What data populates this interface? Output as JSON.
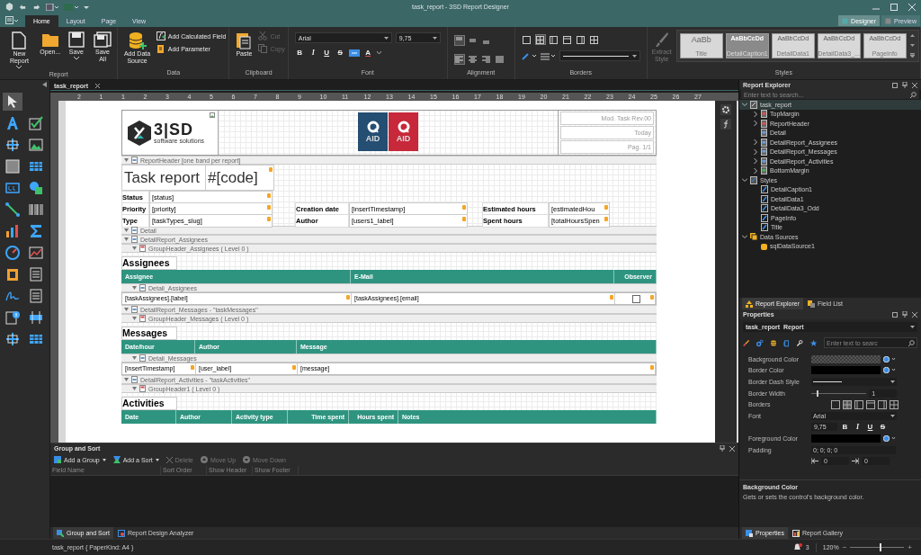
{
  "window": {
    "title": "task_report - 3SD Report Designer"
  },
  "ribbon_tabs": [
    {
      "label": "Home",
      "selected": true
    },
    {
      "label": "Layout",
      "selected": false
    },
    {
      "label": "Page",
      "selected": false
    },
    {
      "label": "View",
      "selected": false
    }
  ],
  "view_switch": [
    {
      "label": "Designer",
      "selected": true
    },
    {
      "label": "Preview",
      "selected": false
    }
  ],
  "ribbon": {
    "report": {
      "title": "Report",
      "buttons": [
        {
          "label": "New Report",
          "dropdown": true
        },
        {
          "label": "Open...",
          "dropdown": false
        },
        {
          "label": "Save",
          "dropdown": true
        },
        {
          "label": "Save All",
          "dropdown": false
        }
      ]
    },
    "data": {
      "title": "Data",
      "large": {
        "label": "Add Data Source"
      },
      "small": [
        {
          "label": "Add Calculated Field"
        },
        {
          "label": "Add Parameter"
        }
      ]
    },
    "clipboard": {
      "title": "Clipboard",
      "large": {
        "label": "Paste"
      },
      "small": [
        {
          "label": "Cut",
          "disabled": true
        },
        {
          "label": "Copy",
          "disabled": true
        }
      ]
    },
    "font": {
      "title": "Font",
      "family": "Arial",
      "size": "9,75",
      "styles": [
        "B",
        "I",
        "U",
        "S"
      ],
      "color_letter": "A"
    },
    "alignment": {
      "title": "Alignment",
      "buttons": [
        {
          "selected": true
        },
        {
          "selected": false
        },
        {
          "selected": false
        },
        {
          "selected": true
        },
        {
          "selected": false
        },
        {
          "selected": false
        },
        {
          "selected": false
        }
      ]
    },
    "borders": {
      "title": "Borders",
      "buttons": [
        {
          "selected": false
        },
        {
          "selected": true
        },
        {
          "selected": false
        },
        {
          "selected": false
        },
        {
          "selected": false
        },
        {
          "selected": false
        }
      ]
    },
    "styles": {
      "title": "Styles",
      "extract": {
        "label": "Extract Style",
        "disabled": true
      },
      "gallery": [
        {
          "sample": "AaBb",
          "name": "Title",
          "selected": false
        },
        {
          "sample": "AaBbCcDd",
          "name": "DetailCaption1",
          "selected": true
        },
        {
          "sample": "AaBbCcDd",
          "name": "DetailData1",
          "selected": false
        },
        {
          "sample": "AaBbCcDd",
          "name": "DetailData3_...",
          "selected": false
        },
        {
          "sample": "AaBbCcDd",
          "name": "PageInfo",
          "selected": false
        }
      ]
    }
  },
  "toolbox_pointer": {
    "selected": true
  },
  "document_tab": {
    "label": "task_report"
  },
  "ruler": [
    "2",
    "1",
    "1",
    "2",
    "3",
    "4",
    "5",
    "6",
    "7",
    "8",
    "9",
    "10",
    "11",
    "12",
    "13",
    "14",
    "15",
    "16",
    "17",
    "18",
    "19",
    "20",
    "21",
    "22",
    "23",
    "24",
    "25",
    "26",
    "27"
  ],
  "report": {
    "logo": {
      "mark": "3|SD",
      "tagline": "software solutions"
    },
    "badges": [
      "AID",
      "AID"
    ],
    "page_info": [
      "Mod. Task Rev.00",
      "Today",
      "Pag. 1/1"
    ],
    "items": [
      {
        "kind": "band",
        "label": "ReportHeader [one band per report]"
      },
      {
        "kind": "title",
        "text": "Task report",
        "code": "#[code]"
      },
      {
        "kind": "fields",
        "rows": [
          [
            {
              "label": "Status",
              "value": "[status]"
            }
          ],
          [
            {
              "label": "Priority",
              "value": "[priority]"
            },
            {
              "label": "Creation date",
              "value": "[insertTimestamp]"
            },
            {
              "label": "Estimated hours",
              "value": "[estimatedHou"
            }
          ],
          [
            {
              "label": "Type",
              "value": "[taskTypes_slug]"
            },
            {
              "label": "Author",
              "value": "[users1_label]"
            },
            {
              "label": "Spent hours",
              "value": "[totalHoursSpen"
            }
          ]
        ]
      },
      {
        "kind": "band",
        "label": "Detail"
      },
      {
        "kind": "band",
        "label": "DetailReport_Assignees"
      },
      {
        "kind": "sub_band",
        "label": "GroupHeader_Assignees ( Level 0 )"
      },
      {
        "kind": "table",
        "heading": "Assignees",
        "columns": [
          "Assignee",
          "E-Mail",
          "Observer"
        ],
        "detail_band": "Detail_Assignees",
        "row": [
          {
            "kind": "text",
            "text": "[taskAssignees].[label]"
          },
          {
            "kind": "text",
            "text": "[taskAssignees].[email]"
          },
          {
            "kind": "checkbox",
            "checked": false
          }
        ]
      },
      {
        "kind": "band",
        "label": "DetailReport_Messages - \"taskMessages\""
      },
      {
        "kind": "sub_band",
        "label": "GroupHeader_Messages ( Level 0 )"
      },
      {
        "kind": "table",
        "heading": "Messages",
        "columns": [
          "Date/hour",
          "Author",
          "Message"
        ],
        "detail_band": "Detail_Messages",
        "row": [
          {
            "kind": "text",
            "text": "[insertTimestamp]"
          },
          {
            "kind": "text",
            "text": "[user_label]"
          },
          {
            "kind": "text",
            "text": "[message]"
          }
        ]
      },
      {
        "kind": "band",
        "label": "DetailReport_Activities - \"taskActivities\""
      },
      {
        "kind": "sub_band",
        "label": "GroupHeader1 ( Level 0 )"
      },
      {
        "kind": "table",
        "heading": "Activities",
        "columns": [
          "Date",
          "Author",
          "Activity type",
          "Time spent",
          "Hours spent",
          "Notes"
        ]
      }
    ]
  },
  "group_sort": {
    "title": "Group and Sort",
    "toolbar": [
      {
        "label": "Add a Group",
        "disabled": false
      },
      {
        "label": "Add a Sort",
        "disabled": false
      },
      {
        "label": "Delete",
        "disabled": true
      },
      {
        "label": "Move Up",
        "disabled": true
      },
      {
        "label": "Move Down",
        "disabled": true
      }
    ],
    "columns": [
      "Field Name",
      "Sort Order",
      "Show Header",
      "Show Footer"
    ]
  },
  "bottom_tabs": [
    {
      "label": "Group and Sort",
      "selected": true
    },
    {
      "label": "Report Design Analyzer",
      "selected": false
    }
  ],
  "explorer": {
    "title": "Report Explorer",
    "search": {
      "placeholder": "Enter text to search..."
    },
    "tree": [
      {
        "label": "task_report",
        "selected": true,
        "expanded": true,
        "children": [
          {
            "label": "TopMargin",
            "selected": false,
            "expanded": false
          },
          {
            "label": "ReportHeader",
            "selected": false,
            "expanded": false
          },
          {
            "label": "Detail",
            "selected": false
          },
          {
            "label": "DetailReport_Assignees",
            "selected": false,
            "expanded": false
          },
          {
            "label": "DetailReport_Messages",
            "selected": false,
            "expanded": false
          },
          {
            "label": "DetailReport_Activities",
            "selected": false,
            "expanded": false
          },
          {
            "label": "BottomMargin",
            "selected": false,
            "expanded": false
          }
        ]
      },
      {
        "label": "Styles",
        "selected": false,
        "expanded": true,
        "children": [
          {
            "label": "DetailCaption1",
            "selected": false
          },
          {
            "label": "DetailData1",
            "selected": false
          },
          {
            "label": "DetailData3_Odd",
            "selected": false
          },
          {
            "label": "PageInfo",
            "selected": false
          },
          {
            "label": "Title",
            "selected": false
          }
        ]
      },
      {
        "label": "Data Sources",
        "selected": false,
        "expanded": true,
        "children": [
          {
            "label": "sqlDataSource1",
            "selected": false
          }
        ]
      }
    ]
  },
  "explorer_tabs": [
    {
      "label": "Report Explorer",
      "selected": true
    },
    {
      "label": "Field List",
      "selected": false
    }
  ],
  "properties": {
    "title": "Properties",
    "object": "task_report",
    "object_type": "Report",
    "search": {
      "placeholder": "Enter text to searc"
    },
    "rows": [
      {
        "kind": "color_none",
        "label": "Background Color"
      },
      {
        "kind": "color",
        "label": "Border Color",
        "color": "#000000"
      },
      {
        "kind": "line",
        "label": "Border Dash Style"
      },
      {
        "kind": "slider",
        "label": "Border Width",
        "level": 0.1,
        "value": "1"
      },
      {
        "kind": "borders",
        "label": "Borders"
      },
      {
        "kind": "font",
        "label": "Font",
        "value": "Arial"
      },
      {
        "kind": "font_style",
        "value": "9,75",
        "styles": [
          "B",
          "I",
          "U",
          "S"
        ]
      },
      {
        "kind": "color",
        "label": "Foreground Color",
        "color": "#000000"
      },
      {
        "kind": "text",
        "label": "Padding",
        "value": "0; 0; 0; 0"
      },
      {
        "kind": "sides",
        "values": [
          "0",
          "0"
        ]
      }
    ],
    "help": {
      "title": "Background Color",
      "text": "Gets or sets the control's background color."
    }
  },
  "properties_tabs": [
    {
      "label": "Properties",
      "selected": true
    },
    {
      "label": "Report Gallery",
      "selected": false
    }
  ],
  "status": {
    "text": "task_report { PaperKind: A4 }",
    "notifications": "3",
    "zoom": "120%",
    "minus": "−",
    "plus": "+",
    "level": 0.55
  }
}
